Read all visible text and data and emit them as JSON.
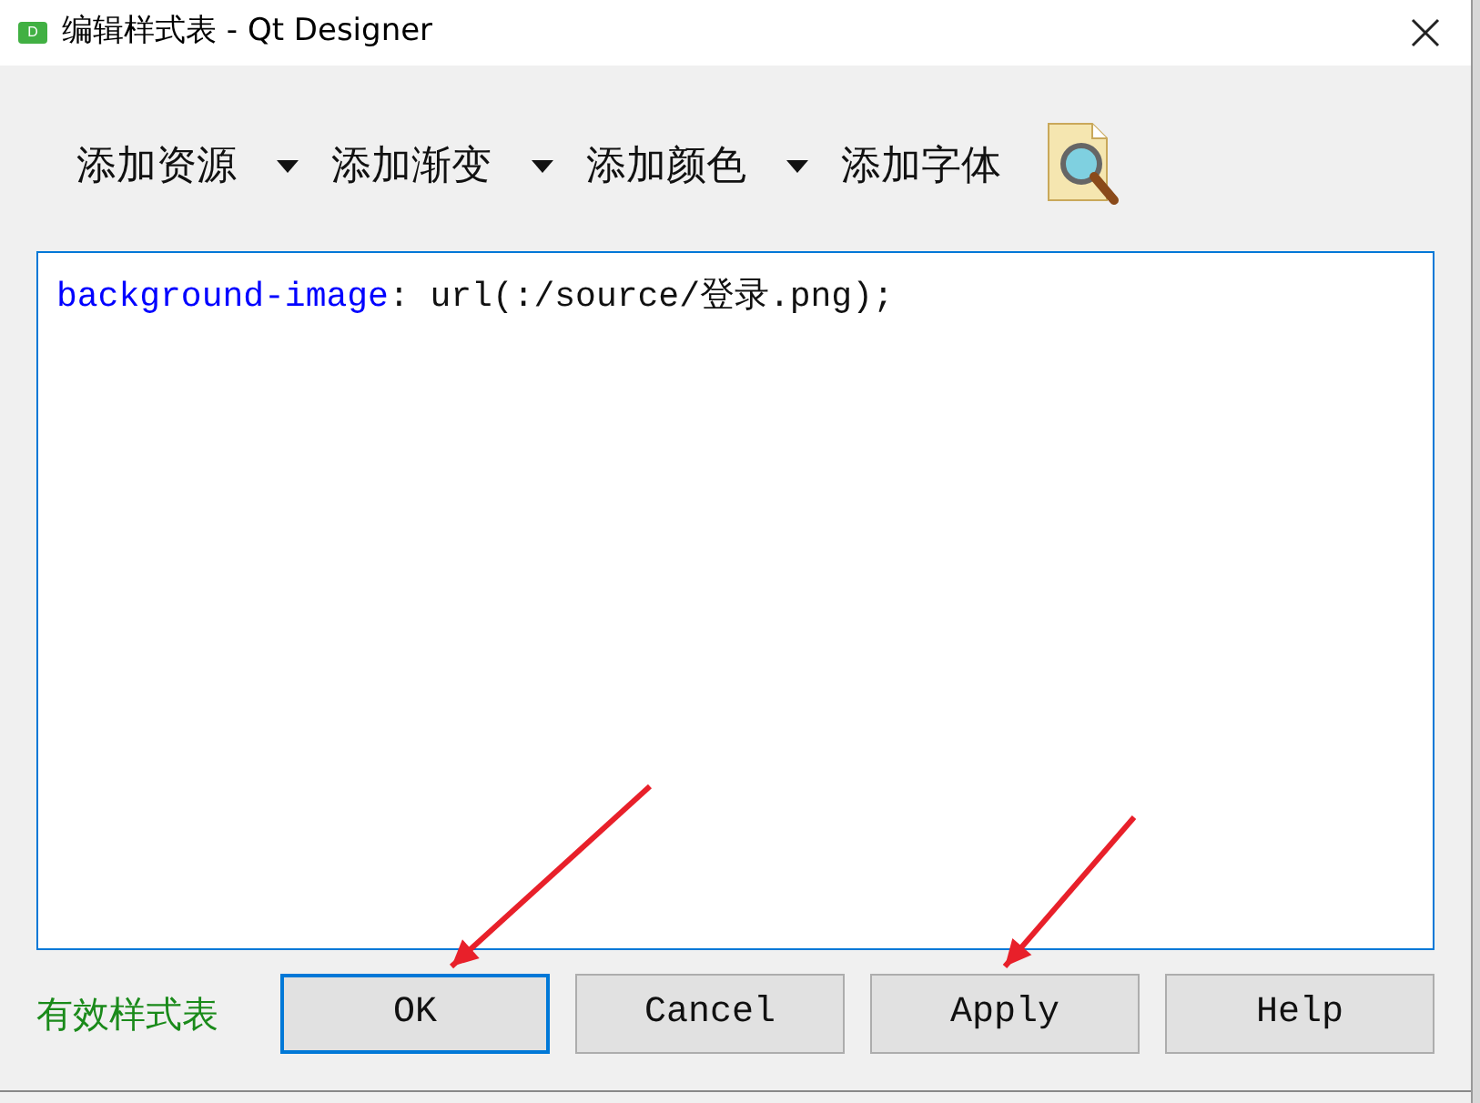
{
  "window": {
    "title": "编辑样式表 - Qt Designer",
    "app_badge": "D"
  },
  "toolbar": [
    {
      "label": "添加资源",
      "kind": "menu"
    },
    {
      "label": "添加渐变",
      "kind": "menu"
    },
    {
      "label": "添加颜色",
      "kind": "menu"
    },
    {
      "label": "添加字体",
      "kind": "plain"
    }
  ],
  "editor": {
    "property": "background-image",
    "value": ": url(:/source/登录.png);"
  },
  "status": "有效样式表",
  "buttons": [
    {
      "label": "OK",
      "focused": true
    },
    {
      "label": "Cancel",
      "focused": false
    },
    {
      "label": "Apply",
      "focused": false
    },
    {
      "label": "Help",
      "focused": false
    }
  ]
}
